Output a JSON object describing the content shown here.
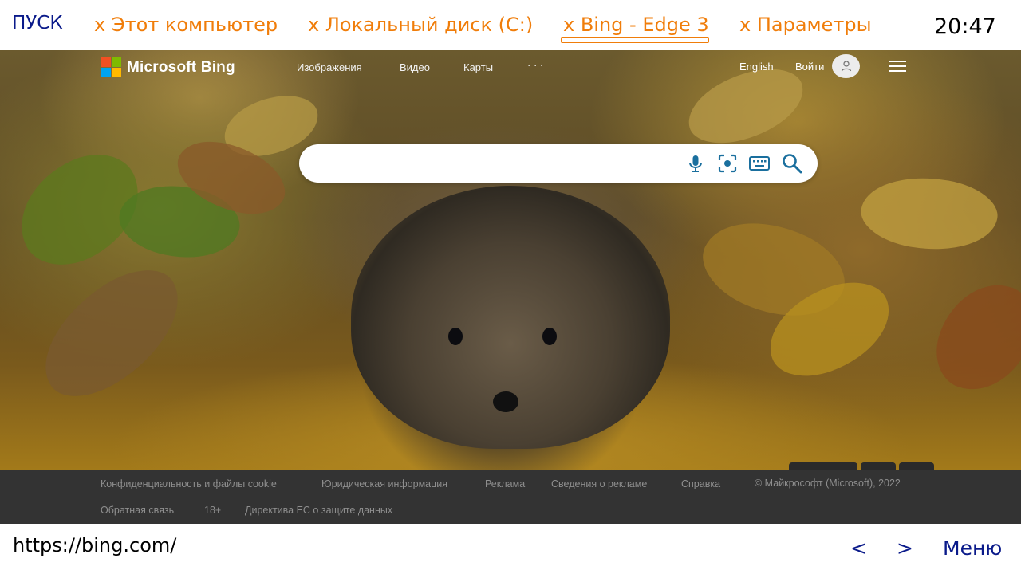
{
  "taskbar": {
    "start_label": "ПУСК",
    "tasks": [
      {
        "label": "x Этот компьютер"
      },
      {
        "label": "x Локальный диск (C:)"
      },
      {
        "label": "x Bing - Edge 3"
      },
      {
        "label": "x Параметры"
      }
    ],
    "active_task": "x Bing - Edge 3",
    "clock": "20:47"
  },
  "bing": {
    "logo_text": "Microsoft Bing",
    "nav": [
      "Изображения",
      "Видео",
      "Карты",
      "· · ·"
    ],
    "language": "English",
    "signin": "Войти",
    "search": {
      "value": "",
      "placeholder": ""
    },
    "icons": [
      "microphone-icon",
      "visual-search-icon",
      "keyboard-icon",
      "search-icon"
    ]
  },
  "footer": {
    "links_row1": [
      "Конфиденциальность и файлы cookie",
      "Юридическая информация",
      "Реклама",
      "Сведения о рекламе",
      "Справка"
    ],
    "copyright": "© Майкрософт (Microsoft), 2022",
    "links_row2": [
      "Обратная связь",
      "18+",
      "Директива ЕС о защите данных"
    ]
  },
  "bottombar": {
    "url": "https://bing.com/",
    "back": "<",
    "forward": ">",
    "menu": "Меню"
  },
  "colors": {
    "task_orange": "#f07d0a",
    "nav_blue": "#0a1a8a",
    "footer_bg": "#333333",
    "bing_icon_blue": "#1a6f9e"
  }
}
